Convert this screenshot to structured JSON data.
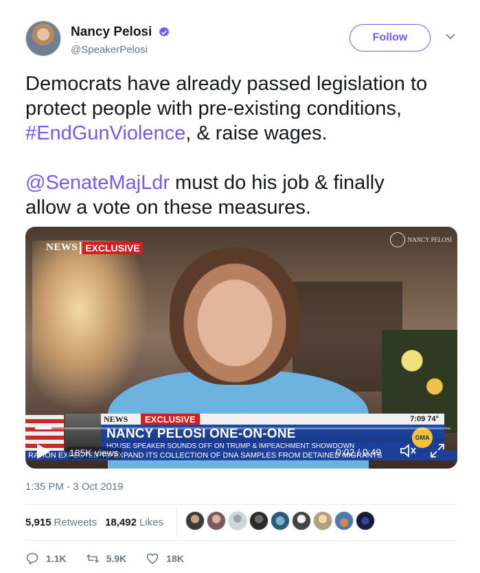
{
  "author": {
    "name": "Nancy Pelosi",
    "handle": "@SpeakerPelosi",
    "verified": true
  },
  "follow_label": "Follow",
  "tweet": {
    "line1": "Democrats have already passed legislation to",
    "line2": "protect people with pre-existing conditions,",
    "hashtag": "#EndGunViolence",
    "line3_rest": ", & raise wages.",
    "mention": "@SenateMajLdr",
    "line4_rest": " must do his job & finally",
    "line5": "allow a vote on these measures."
  },
  "video": {
    "logo_news": "NEWS",
    "logo_exclusive": "EXCLUSIVE",
    "watermark": "NANCY PELOSI",
    "lower_news": "NEWS",
    "lower_exclusive": "EXCLUSIVE",
    "clock": "7:09  74°",
    "headline": "NANCY PELOSI ONE-ON-ONE",
    "subline": "HOUSE SPEAKER SOUNDS OFF ON TRUMP & IMPEACHMENT SHOWDOWN",
    "ticker": "RATION EXPECTED TO EXPAND ITS COLLECTION OF DNA SAMPLES FROM DETAINED MIGRANTS",
    "gma": "GMA",
    "views": "185K views",
    "time": "0:02 / 0:49",
    "progress": 0.04
  },
  "timestamp": "1:35 PM - 3 Oct 2019",
  "stats": {
    "retweets_count": "5,915",
    "retweets_label": "Retweets",
    "likes_count": "18,492",
    "likes_label": "Likes"
  },
  "actions": {
    "replies": "1.1K",
    "retweets": "5.9K",
    "likes": "18K"
  },
  "colors": {
    "accent": "#7856ff",
    "muted": "#657786",
    "text": "#14171a"
  }
}
